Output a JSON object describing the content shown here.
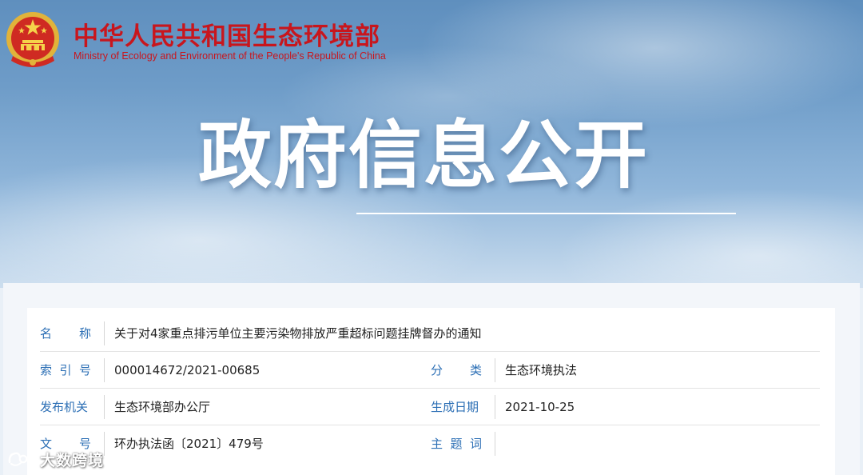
{
  "header": {
    "ministry_cn": "中华人民共和国生态环境部",
    "ministry_en": "Ministry of Ecology and Environment of the People's Republic of China",
    "brand_color": "#c8161d",
    "emblem_icon": "national-emblem-icon"
  },
  "banner": {
    "title": "政府信息公开"
  },
  "info": {
    "label_color": "#2c6fb5",
    "name_label": "名称",
    "name_value": "关于对4家重点排污单位主要污染物排放严重超标问题挂牌督办的通知",
    "index_label": "索引号",
    "index_value": "000014672/2021-00685",
    "category_label": "分类",
    "category_value": "生态环境执法",
    "issuer_label": "发布机关",
    "issuer_value": "生态环境部办公厅",
    "date_label": "生成日期",
    "date_value": "2021-10-25",
    "docno_label": "文号",
    "docno_value": "环办执法函〔2021〕479号",
    "subject_label": "主题词",
    "subject_value": ""
  },
  "watermark": {
    "text": "大数跨境",
    "icon": "watermark-logo-icon"
  }
}
